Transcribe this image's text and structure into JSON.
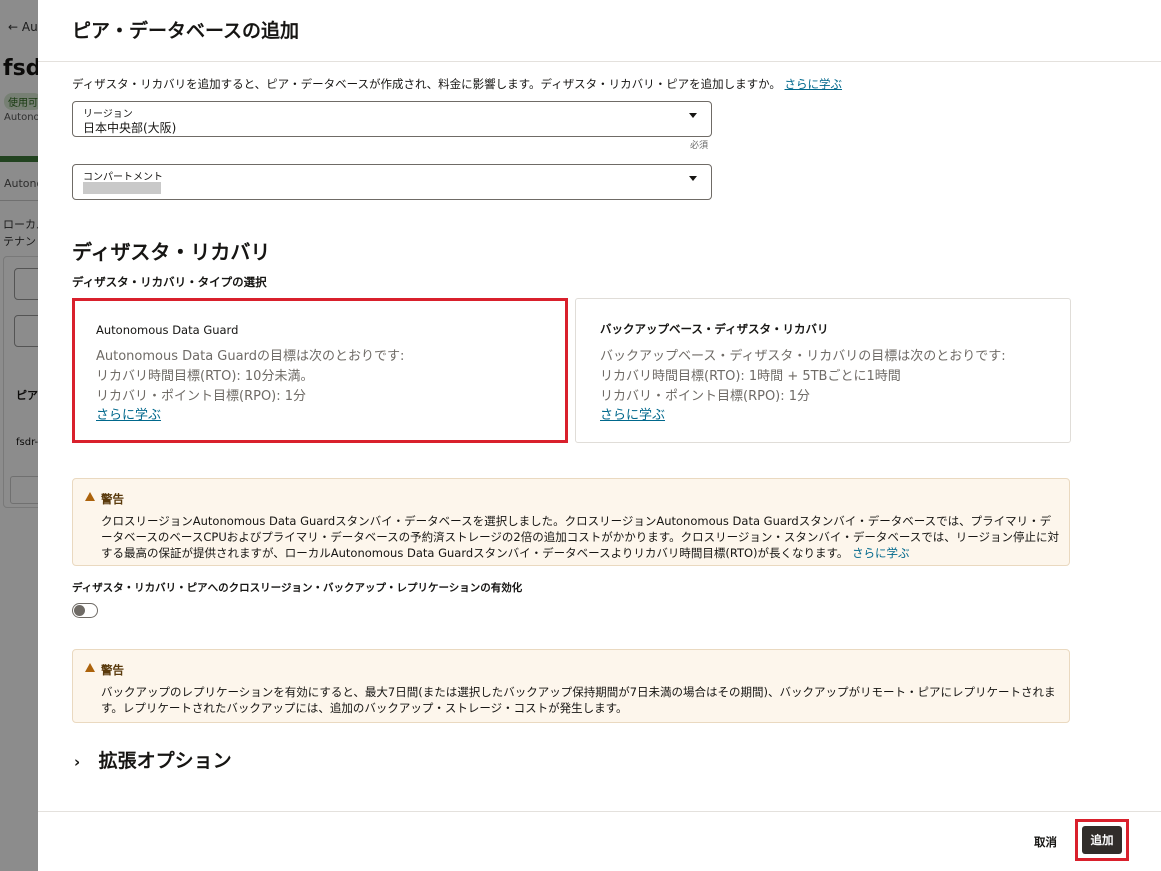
{
  "background": {
    "back_link": "← Au",
    "title": "fsdr",
    "badge": "使用可",
    "subtitle": "Autono",
    "tab": "Autono",
    "text1": "ローカル",
    "text2": "テナン",
    "col_header": "ピア",
    "row_text": "fsdr-"
  },
  "drawer": {
    "title": "ピア・データベースの追加",
    "intro_text": "ディザスタ・リカバリを追加すると、ピア・データベースが作成され、料金に影響します。ディザスタ・リカバリ・ピアを追加しますか。",
    "intro_link": "さらに学ぶ",
    "region": {
      "label": "リージョン",
      "value": "日本中央部(大阪)",
      "required": "必須"
    },
    "compartment": {
      "label": "コンパートメント"
    },
    "dr_heading": "ディザスタ・リカバリ",
    "dr_type_label": "ディザスタ・リカバリ・タイプの選択",
    "cards": [
      {
        "title": "Autonomous Data Guard",
        "line1": "Autonomous Data Guardの目標は次のとおりです:",
        "line2": "リカバリ時間目標(RTO): 10分未満。",
        "line3": "リカバリ・ポイント目標(RPO): 1分",
        "link": "さらに学ぶ"
      },
      {
        "title": "バックアップベース・ディザスタ・リカバリ",
        "line1": "バックアップベース・ディザスタ・リカバリの目標は次のとおりです:",
        "line2": "リカバリ時間目標(RTO): 1時間 + 5TBごとに1時間",
        "line3": "リカバリ・ポイント目標(RPO): 1分",
        "link": "さらに学ぶ"
      }
    ],
    "warning1": {
      "title": "警告",
      "body": "クロスリージョンAutonomous Data Guardスタンバイ・データベースを選択しました。クロスリージョンAutonomous Data Guardスタンバイ・データベースでは、プライマリ・データベースのベースCPUおよびプライマリ・データベースの予約済ストレージの2倍の追加コストがかかります。クロスリージョン・スタンバイ・データベースでは、リージョン停止に対する最高の保証が提供されますが、ローカルAutonomous Data Guardスタンバイ・データベースよりリカバリ時間目標(RTO)が長くなります。",
      "link": "さらに学ぶ"
    },
    "toggle_label": "ディザスタ・リカバリ・ピアへのクロスリージョン・バックアップ・レプリケーションの有効化",
    "toggle_state": "off",
    "warning2": {
      "title": "警告",
      "body": "バックアップのレプリケーションを有効にすると、最大7日間(または選択したバックアップ保持期間が7日未満の場合はその期間)、バックアップがリモート・ピアにレプリケートされます。レプリケートされたバックアップには、追加のバックアップ・ストレージ・コストが発生します。"
    },
    "advanced": "拡張オプション",
    "cancel": "取消",
    "add": "追加"
  },
  "colors": {
    "accent_red": "#d9202c",
    "link": "#00688c",
    "primary_button": "#312d2a",
    "warning_bg": "#fdf6ec"
  }
}
